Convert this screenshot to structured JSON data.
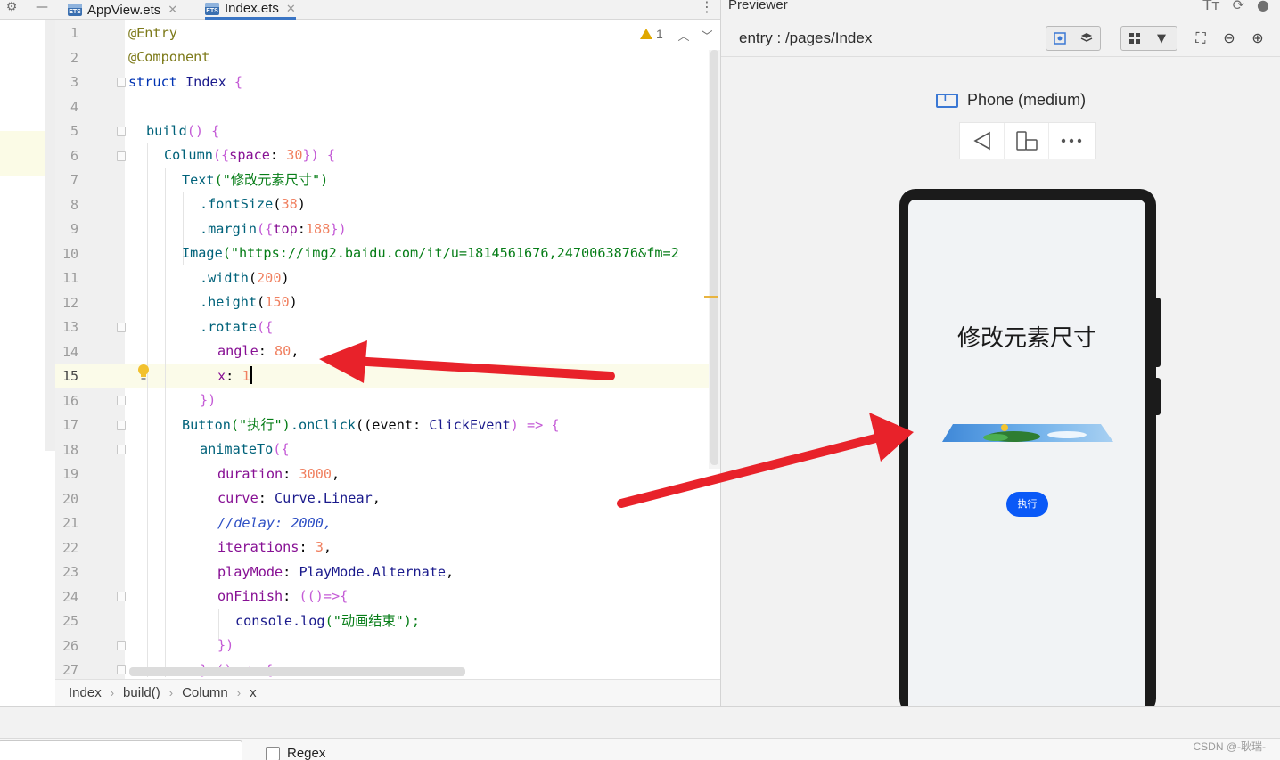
{
  "editor": {
    "tabs": [
      {
        "label": "AppView.ets",
        "active": false
      },
      {
        "label": "Index.ets",
        "active": true
      }
    ],
    "warning_count": "1",
    "line_numbers": [
      "1",
      "2",
      "3",
      "4",
      "5",
      "6",
      "7",
      "8",
      "9",
      "10",
      "11",
      "12",
      "13",
      "14",
      "15",
      "16",
      "17",
      "18",
      "19",
      "20",
      "21",
      "22",
      "23",
      "24",
      "25",
      "26",
      "27"
    ],
    "current_line": "15",
    "code": [
      {
        "t": "@Entry"
      },
      {
        "t": "@Component"
      },
      {
        "kw": "struct",
        "name": "Index",
        "tail": "{"
      },
      {
        "t": ""
      },
      {
        "fn": "build",
        "tail": "() {"
      },
      {
        "fn": "Column",
        "a": "({",
        "p": "space",
        "c": ": ",
        "n": "30",
        "z": "}) {"
      },
      {
        "fn": "Text",
        "s": "(\"修改元素尺寸\")"
      },
      {
        "m": ".fontSize",
        "o": "(",
        "n": "38",
        "z": ")"
      },
      {
        "m": ".margin",
        "o": "({",
        "p": "top",
        "c": ":",
        "n": "188",
        "z": "})"
      },
      {
        "fn": "Image",
        "s": "(\"https://img2.baidu.com/it/u=1814561676,2470063876&fm=2"
      },
      {
        "m": ".width",
        "o": "(",
        "n": "200",
        "z": ")"
      },
      {
        "m": ".height",
        "o": "(",
        "n": "150",
        "z": ")"
      },
      {
        "m": ".rotate",
        "o": "({"
      },
      {
        "p": "angle",
        "c": ": ",
        "n": "80",
        "z": ","
      },
      {
        "p": "x",
        "c": ": ",
        "n": "1"
      },
      {
        "z": "})"
      },
      {
        "fn": "Button",
        "s": "(\"执行\")",
        "m": ".onClick",
        "o": "((event: ",
        "ty": "ClickEvent",
        "z": ") => {"
      },
      {
        "fn": "animateTo",
        "o": "({"
      },
      {
        "p": "duration",
        "c": ": ",
        "n": "3000",
        "z": ","
      },
      {
        "p": "curve",
        "c": ": ",
        "id": "Curve.Linear",
        "z": ","
      },
      {
        "cm": "//delay: 2000,"
      },
      {
        "p": "iterations",
        "c": ": ",
        "n": "3",
        "z": ","
      },
      {
        "p": "playMode",
        "c": ": ",
        "id": "PlayMode.Alternate",
        "z": ","
      },
      {
        "p": "onFinish",
        "c": ": ",
        "o": "(()=>{"
      },
      {
        "m": "console.log",
        "s": "(\"动画结束\");"
      },
      {
        "z": "})"
      },
      {
        "z": "},() => {"
      }
    ],
    "breadcrumb": [
      "Index",
      "build()",
      "Column",
      "x"
    ]
  },
  "previewer": {
    "title": "Previewer",
    "entry": "entry : /pages/Index",
    "device": "Phone (medium)",
    "app": {
      "title": "修改元素尺寸",
      "button_label": "执行"
    }
  },
  "find": {
    "regex_label": "Regex"
  },
  "watermark": "CSDN @-耿瑞-",
  "colors": {
    "accent": "#3a75c4",
    "app_button": "#0a59f7",
    "annotation_arrow": "#e8222a"
  }
}
